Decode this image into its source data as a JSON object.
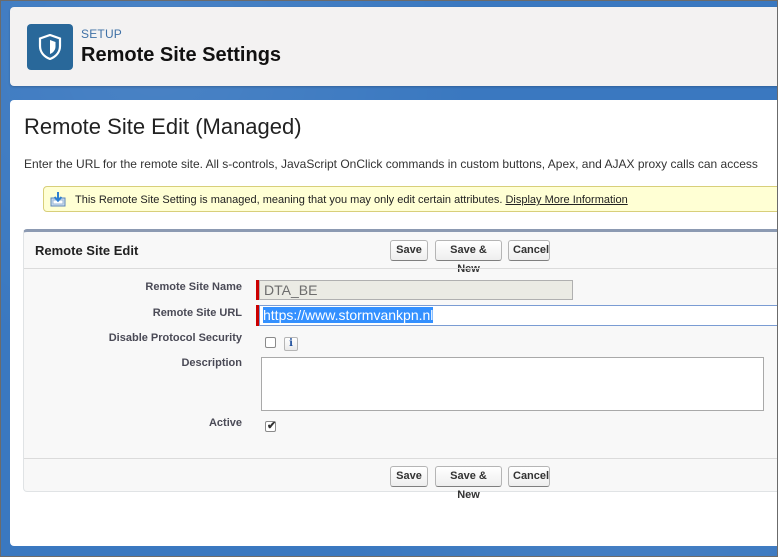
{
  "header": {
    "eyebrow": "SETUP",
    "title": "Remote Site Settings",
    "icon": "shield-icon"
  },
  "page": {
    "title": "Remote Site Edit (Managed)",
    "intro": "Enter the URL for the remote site. All s-controls, JavaScript OnClick commands in custom buttons, Apex, and AJAX proxy calls can access"
  },
  "notice": {
    "text": "This Remote Site Setting is managed, meaning that you may only edit certain attributes.",
    "link": "Display More Information",
    "icon": "download-info-icon"
  },
  "panel": {
    "title": "Remote Site Edit",
    "buttons": {
      "save": "Save",
      "save_new": "Save & New",
      "cancel": "Cancel"
    }
  },
  "form": {
    "name_label": "Remote Site Name",
    "name_value": "DTA_BE",
    "url_label": "Remote Site URL",
    "url_value": "https://www.stormvankpn.nl",
    "protocol_label": "Disable Protocol Security",
    "protocol_checked": false,
    "info_glyph": "i",
    "description_label": "Description",
    "description_value": "",
    "active_label": "Active",
    "active_checked": true,
    "active_mark": "✔"
  },
  "colors": {
    "header_icon_bg": "#29689a",
    "required": "#cc0000",
    "selection": "#3390ff"
  }
}
